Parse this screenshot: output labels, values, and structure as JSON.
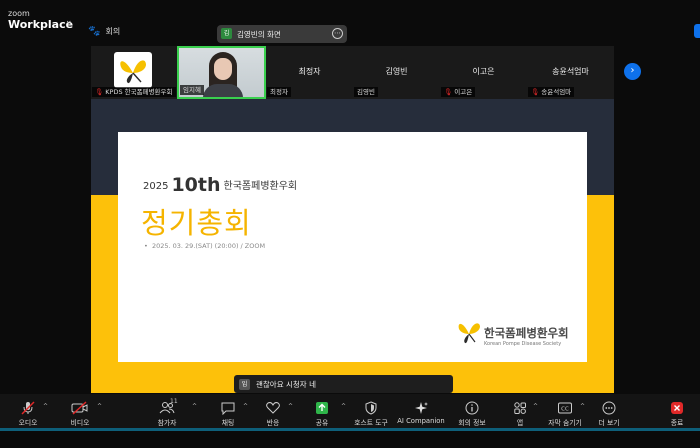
{
  "app": {
    "brand_small": "zoom",
    "brand_big": "Workplace",
    "meeting_label": "회의"
  },
  "sharing": {
    "badge": "김",
    "label": "김영빈의 화면"
  },
  "participants": [
    {
      "tag": "KPDS 한국폼페병환우회",
      "muted": true
    },
    {
      "tag": "임지혜",
      "muted": false
    },
    {
      "center": "최정자",
      "tag": "최정자",
      "muted": false
    },
    {
      "center": "김영빈",
      "tag": "김영빈",
      "muted": false
    },
    {
      "center": "이고은",
      "tag": "이고은",
      "muted": true
    },
    {
      "center": "송윤석엄마",
      "tag": "송윤석엄마",
      "muted": true
    }
  ],
  "slide": {
    "year": "2025",
    "edition": "10th",
    "org": "한국폼페병환우회",
    "title": "정기총회",
    "date_line": "2025. 03. 29.(SAT) (20:00) / ZOOM",
    "logo_ko": "한국폼페병환우회",
    "logo_en": "Korean Pompe Disease Society"
  },
  "caption": {
    "badge": "임",
    "text": "괜찮아요 시청자 네"
  },
  "toolbar": {
    "audio": "오디오",
    "video": "비디오",
    "participants": "참가자",
    "participants_count": "11",
    "chat": "채팅",
    "react": "반응",
    "share": "공유",
    "host_tools": "호스트 도구",
    "ai": "AI Companion",
    "info": "회의 정보",
    "apps": "앱",
    "captions": "자막 숨기기",
    "more": "더 보기",
    "end": "종료"
  },
  "colors": {
    "accent": "#0e71eb",
    "slide_yellow": "#fdc10a",
    "slide_navy": "#262d3b",
    "speaker_border": "#3ad04e",
    "muted_red": "#e02828",
    "end_red": "#e02828"
  }
}
